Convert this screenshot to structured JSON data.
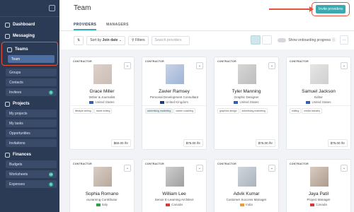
{
  "sidebar": {
    "items": {
      "dashboard": "Dashboard",
      "messaging": "Messaging",
      "teams": "Teams",
      "team": "Team",
      "groups": "Groups",
      "contacts": "Contacts",
      "invitees": "Invitees",
      "invitees_badge": "9",
      "projects": "Projects",
      "my_projects": "My projects",
      "my_tasks": "My tasks",
      "opportunities": "Opportunities",
      "invitations": "Invitations",
      "finances": "Finances",
      "budgets": "Budgets",
      "worksheets": "Worksheets",
      "worksheets_badge": "10",
      "expenses": "Expenses",
      "expenses_badge": "6"
    }
  },
  "header": {
    "title": "Team",
    "invite_button": "Invite providers"
  },
  "tabs": [
    "PROVIDERS",
    "MANAGERS"
  ],
  "toolbar": {
    "sort_label": "Sort by",
    "sort_value": "Join date",
    "filters": "Filters",
    "search_placeholder": "Search providers",
    "onboarding": "Show onboarding progress"
  },
  "cards": [
    {
      "tag": "CONTRACTOR",
      "name": "Grace Miller",
      "role": "Writer & Journalist",
      "country": "United States",
      "skills": [
        "lifestyle writing",
        "travel writing"
      ],
      "rate": "$60.00 /hr"
    },
    {
      "tag": "CONTRACTOR",
      "name": "Zavier Ramsey",
      "role": "Personal Development Consultant",
      "country": "United Kingdom",
      "skills": [
        "advertising marketing",
        "career coaching"
      ],
      "rate": "$75.00 /hr"
    },
    {
      "tag": "CONTRACTOR",
      "name": "Tyler Manning",
      "role": "Graphic Designer",
      "country": "United States",
      "skills": [
        "graphics design",
        "advertising marketing"
      ],
      "rate": "$75.00 /hr"
    },
    {
      "tag": "CONTRACTOR",
      "name": "Samuel Jackson",
      "role": "Editor",
      "country": "United States",
      "skills": [
        "editing",
        "media industry"
      ],
      "rate": "$75.00 /hr"
    },
    {
      "tag": "CONTRACTOR",
      "name": "Sophia Romano",
      "role": "eLearning Contributor",
      "country": "Italy"
    },
    {
      "tag": "CONTRACTOR",
      "name": "William Lee",
      "role": "Senior E-Learning Architect",
      "country": "Canada"
    },
    {
      "tag": "CONTRACTOR",
      "name": "Advik Kumar",
      "role": "Customer Success Manager",
      "country": "India"
    },
    {
      "tag": "CONTRACTOR",
      "name": "Jaya Patil",
      "role": "Project Manager",
      "country": "Canada"
    }
  ]
}
